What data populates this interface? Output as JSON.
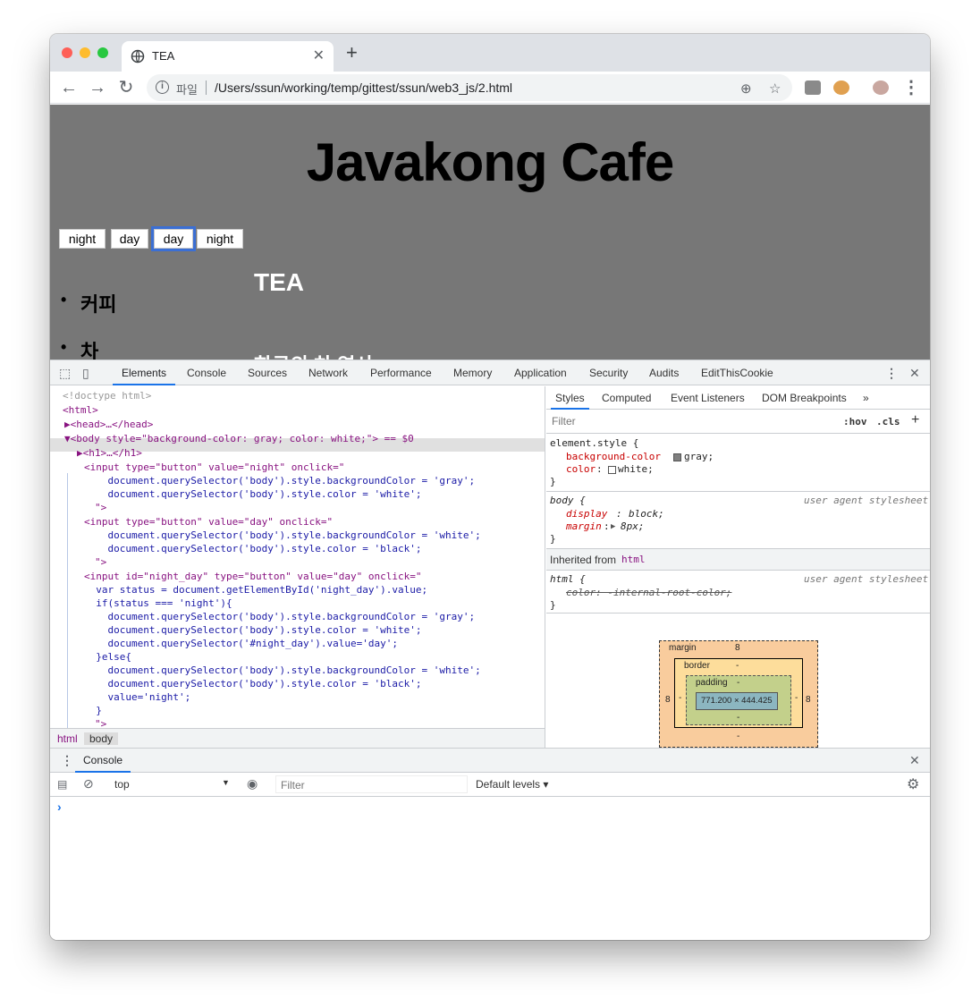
{
  "tab": {
    "title": "TEA"
  },
  "omnibox": {
    "scheme": "파일",
    "url": "/Users/ssun/working/temp/gittest/ssun/web3_js/2.html"
  },
  "page": {
    "heading": "Javakong Cafe",
    "buttons": [
      "night",
      "day",
      "day",
      "night"
    ],
    "list": [
      "커피",
      "차"
    ],
    "section_title": "TEA",
    "partial_text": "한국의 차 역사"
  },
  "devtools": {
    "tabs": [
      "Elements",
      "Console",
      "Sources",
      "Network",
      "Performance",
      "Memory",
      "Application",
      "Security",
      "Audits",
      "EditThisCookie"
    ],
    "code": [
      "<!doctype html>",
      "<html>",
      "▶<head>…</head>",
      "▼<body style=\"background-color: gray; color: white;\"> == $0",
      "▶<h1>…</h1>",
      "<input type=\"button\" value=\"night\" onclick=\"",
      "    document.querySelector('body').style.backgroundColor = 'gray';",
      "    document.querySelector('body').style.color = 'white';",
      "\">",
      "<input type=\"button\" value=\"day\" onclick=\"",
      "    document.querySelector('body').style.backgroundColor = 'white';",
      "    document.querySelector('body').style.color = 'black';",
      "\">",
      "<input id=\"night_day\" type=\"button\" value=\"day\" onclick=\"",
      "  var status = document.getElementById('night_day').value;",
      "  if(status === 'night'){",
      "    document.querySelector('body').style.backgroundColor = 'gray';",
      "    document.querySelector('body').style.color = 'white';",
      "    document.querySelector('#night_day').value='day';",
      "  }else{",
      "    document.querySelector('body').style.backgroundColor = 'white';",
      "    document.querySelector('body').style.color = 'black';",
      "    value='night';",
      "  }",
      "\">"
    ],
    "breadcrumbs": [
      "html",
      "body"
    ],
    "styles_tabs": [
      "Styles",
      "Computed",
      "Event Listeners",
      "DOM Breakpoints"
    ],
    "filter_placeholder": "Filter",
    "hov": ":hov",
    "cls": ".cls",
    "element_style": {
      "selector": "element.style {",
      "bg_prop": "background-color",
      "bg_val": "gray;",
      "color_prop": "color",
      "color_val": "white;",
      "close": "}"
    },
    "body_rule": {
      "selector": "body {",
      "source": "user agent stylesheet",
      "display_prop": "display",
      "display_val": "block;",
      "margin_prop": "margin",
      "margin_val": "8px;",
      "close": "}"
    },
    "inherited": {
      "label": "Inherited from",
      "tag": "html"
    },
    "html_rule": {
      "selector": "html {",
      "source": "user agent stylesheet",
      "color_line": "color: -internal-root-color;",
      "close": "}"
    },
    "box": {
      "margin_label": "margin",
      "margin_val": "8",
      "border_label": "border",
      "border_val": "-",
      "padding_label": "padding",
      "padding_val": "-",
      "content": "771.200 × 444.425",
      "side": "8",
      "dash": "-"
    }
  },
  "drawer": {
    "title": "Console",
    "context": "top",
    "filter_placeholder": "Filter",
    "levels": "Default levels ▾",
    "prompt": "›"
  },
  "colors": {
    "page_bg": "#777777",
    "accent": "#1a73e8"
  }
}
